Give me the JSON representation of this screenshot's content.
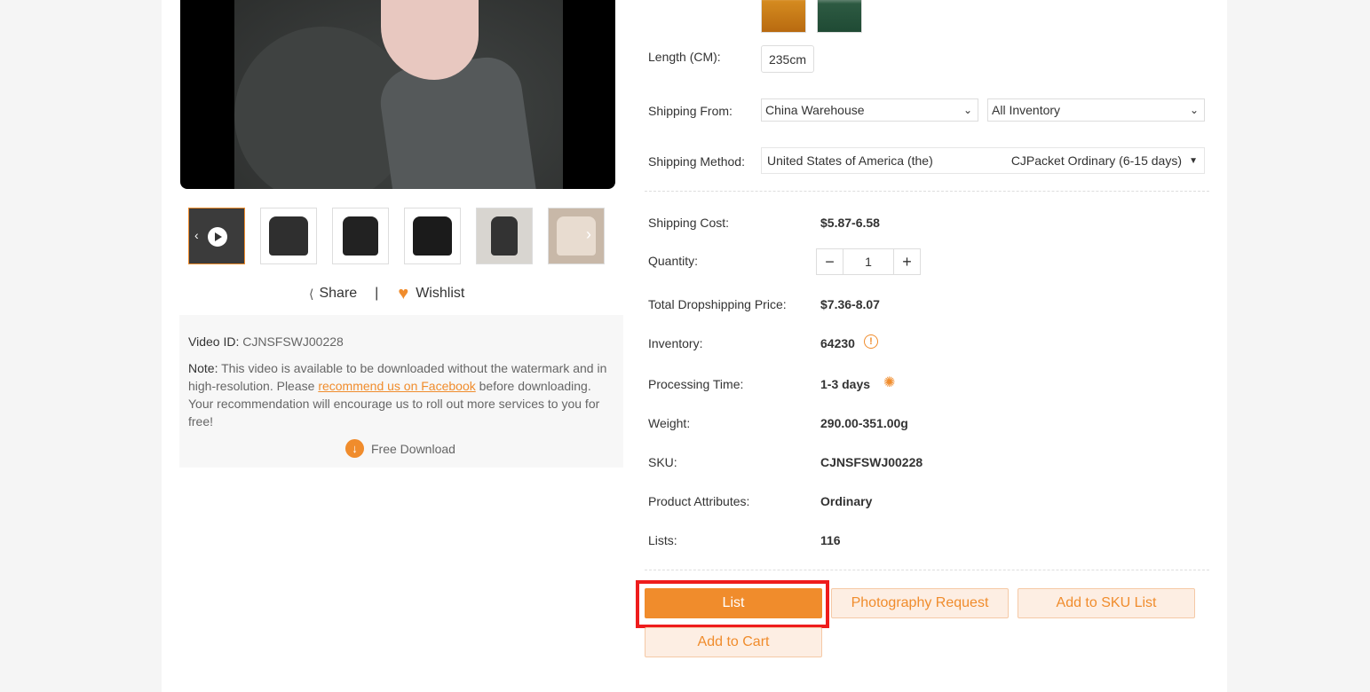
{
  "left": {
    "thumbnails": [
      "video-thumb",
      "scarf-front",
      "scarf-neck",
      "model-front",
      "model-street",
      "model-side"
    ],
    "share_label": "Share",
    "separator": "|",
    "wishlist_label": "Wishlist",
    "note_box": {
      "video_id_label": "Video ID:",
      "video_id": "CJNSFSWJ00228",
      "note_label": "Note:",
      "note_text_1": "This video is available to be downloaded without the watermark and in high-resolution. Please",
      "note_link": "recommend us on Facebook",
      "note_text_2": "before downloading. Your recommendation will encourage us to roll out more services to you for free!",
      "free_download": "Free Download"
    }
  },
  "right": {
    "length_label": "Length (CM):",
    "length_value": "235cm",
    "shipping_from_label": "Shipping From:",
    "shipping_from_value": "China Warehouse",
    "inventory_filter_value": "All Inventory",
    "shipping_method_label": "Shipping Method:",
    "shipping_country": "United States of America (the)",
    "shipping_method_value": "CJPacket Ordinary (6-15 days)",
    "shipping_cost_label": "Shipping Cost:",
    "shipping_cost_value": "$5.87-6.58",
    "quantity_label": "Quantity:",
    "quantity_value": "1",
    "total_price_label": "Total Dropshipping Price:",
    "total_price_value": "$7.36-8.07",
    "inventory_label": "Inventory:",
    "inventory_value": "64230",
    "processing_label": "Processing Time:",
    "processing_value": "1-3 days",
    "weight_label": "Weight:",
    "weight_value": "290.00-351.00g",
    "sku_label": "SKU:",
    "sku_value": "CJNSFSWJ00228",
    "attributes_label": "Product Attributes:",
    "attributes_value": "Ordinary",
    "lists_label": "Lists:",
    "lists_value": "116"
  },
  "actions": {
    "list": "List",
    "photography_request": "Photography Request",
    "add_to_sku_list": "Add to SKU List",
    "add_to_cart": "Add to Cart"
  },
  "colors": {
    "accent": "#f08c2c",
    "highlight": "#ee1c1c"
  }
}
